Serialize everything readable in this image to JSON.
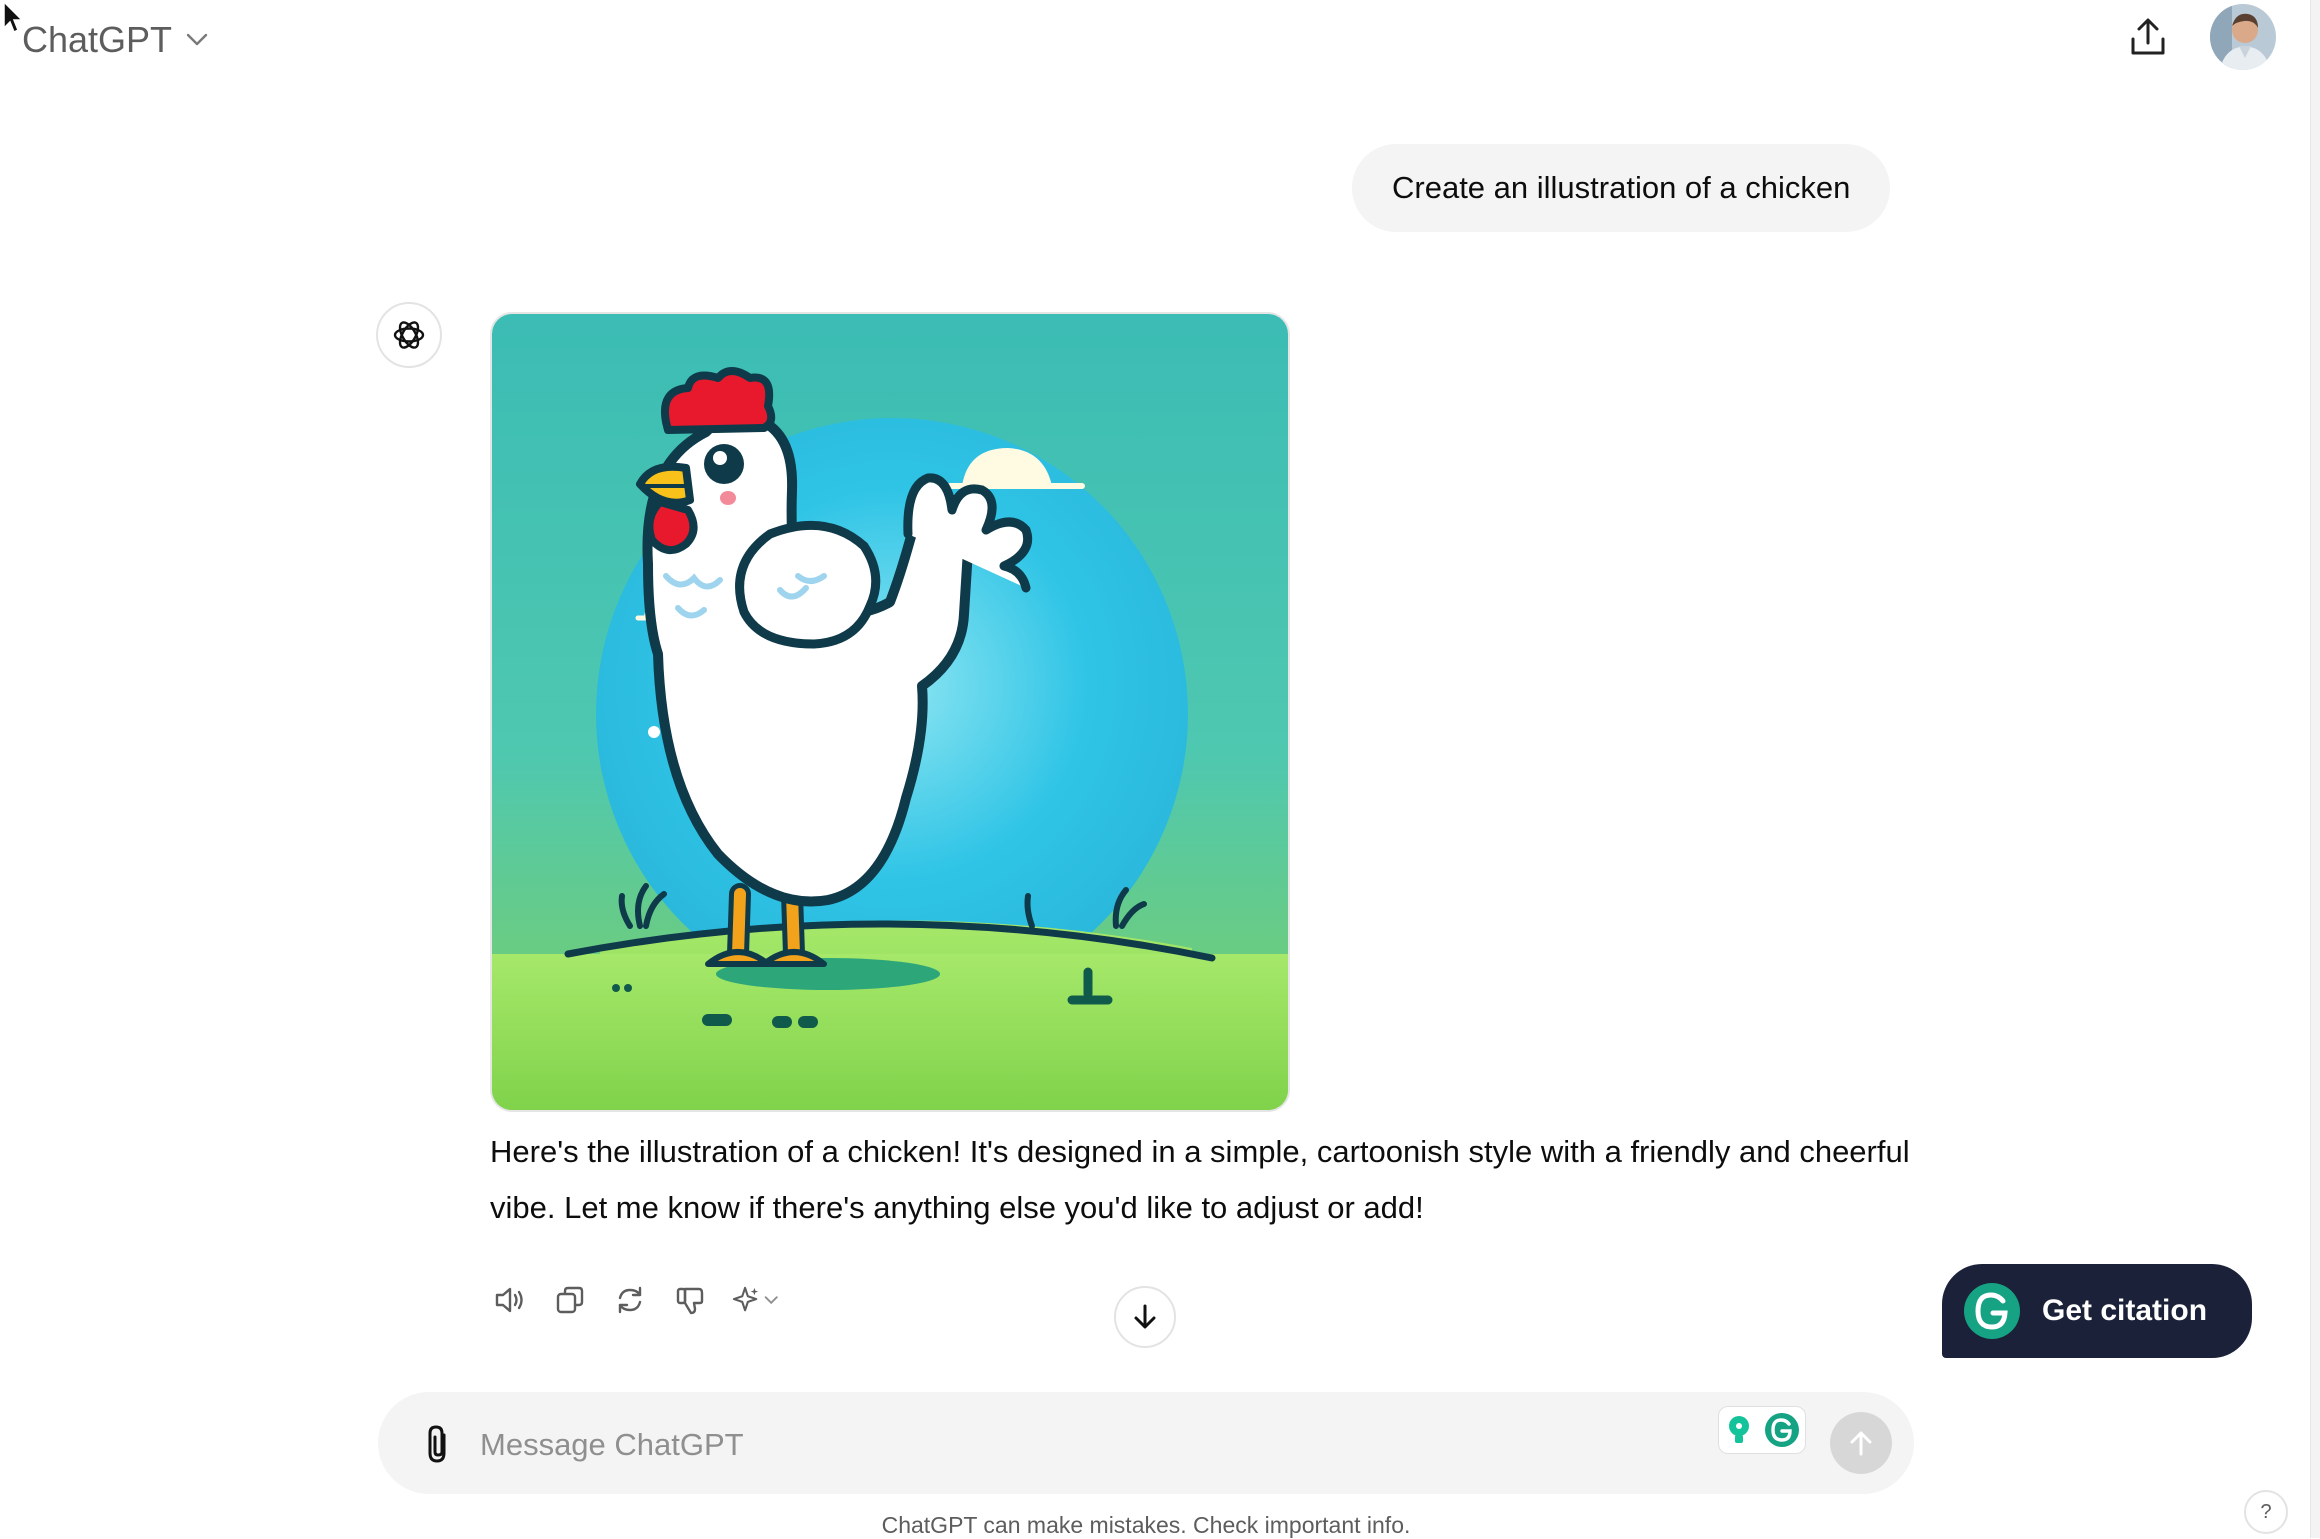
{
  "header": {
    "model_name": "ChatGPT",
    "model_icon": "chevron-down-icon",
    "share_icon": "share-upload-icon",
    "avatar_icon": "user-avatar"
  },
  "conversation": {
    "user_message": "Create an illustration of a chicken",
    "assistant_icon": "openai-logo-icon",
    "image_description_icon": "generated-image-chicken",
    "assistant_text": "Here's the illustration of a chicken! It's designed in a simple, cartoonish style with a friendly and cheerful vibe. Let me know if there's anything else you'd like to adjust or add!",
    "actions": [
      {
        "icon": "speaker-icon"
      },
      {
        "icon": "copy-icon"
      },
      {
        "icon": "regenerate-icon"
      },
      {
        "icon": "thumbs-down-icon"
      },
      {
        "icon": "sparkle-model-icon"
      }
    ]
  },
  "citation": {
    "label": "Get citation",
    "brand_color": "#1a2138",
    "icon": "grammarly-icon"
  },
  "composer": {
    "placeholder": "Message ChatGPT",
    "attach_icon": "paperclip-icon",
    "send_icon": "arrow-up-icon"
  },
  "footer": {
    "disclaimer": "ChatGPT can make mistakes. Check important info.",
    "help_label": "?"
  },
  "colors": {
    "bubble_bg": "#f4f4f4",
    "grammarly_green": "#15c39a",
    "comb_red": "#e8192c"
  }
}
